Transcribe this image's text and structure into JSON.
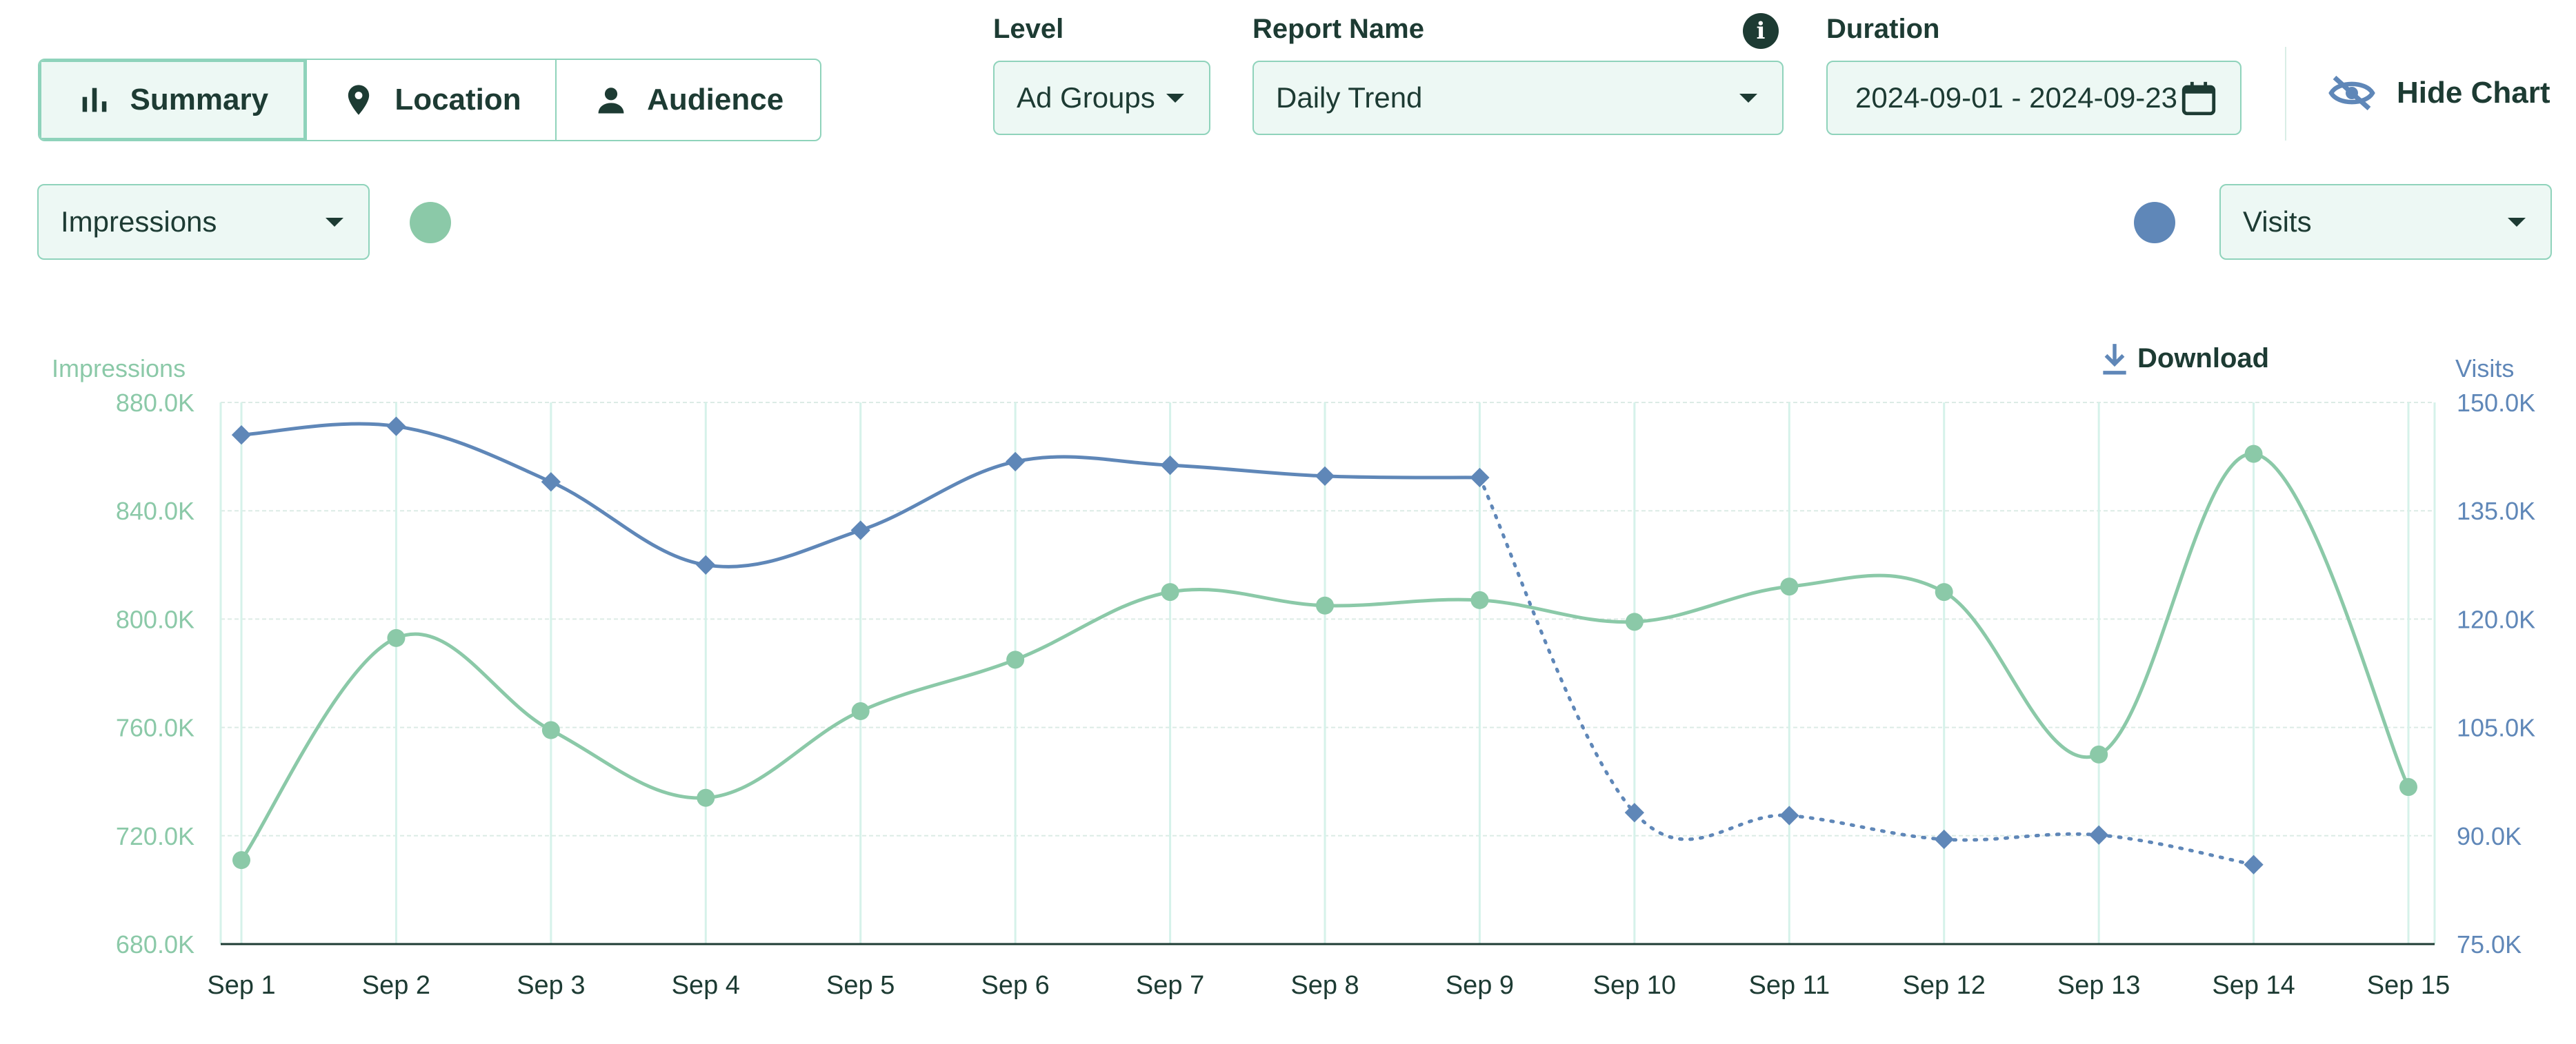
{
  "tabs": [
    {
      "label": "Summary",
      "icon": "bar-chart-icon",
      "active": true
    },
    {
      "label": "Location",
      "icon": "location-pin-icon",
      "active": false
    },
    {
      "label": "Audience",
      "icon": "person-icon",
      "active": false
    }
  ],
  "filters": {
    "level_label": "Level",
    "level_value": "Ad Groups",
    "report_label": "Report Name",
    "report_value": "Daily Trend",
    "duration_label": "Duration",
    "duration_value": "2024-09-01 - 2024-09-23",
    "info_icon": "info-icon",
    "calendar_icon": "calendar-icon"
  },
  "hide_chart_label": "Hide Chart",
  "metric_left": {
    "value": "Impressions",
    "color": "#8bc9a8"
  },
  "metric_right": {
    "value": "Visits",
    "color": "#5f87b8"
  },
  "download_label": "Download",
  "chart_data": {
    "type": "line",
    "x": [
      "Sep 1",
      "Sep 2",
      "Sep 3",
      "Sep 4",
      "Sep 5",
      "Sep 6",
      "Sep 7",
      "Sep 8",
      "Sep 9",
      "Sep 10",
      "Sep 11",
      "Sep 12",
      "Sep 13",
      "Sep 14",
      "Sep 15"
    ],
    "y_left": {
      "label": "Impressions",
      "lim": [
        680,
        880
      ],
      "ticks": [
        "680.0K",
        "720.0K",
        "760.0K",
        "800.0K",
        "840.0K",
        "880.0K"
      ]
    },
    "y_right": {
      "label": "Visits",
      "lim": [
        75,
        150
      ],
      "ticks": [
        "75.0K",
        "90.0K",
        "105.0K",
        "120.0K",
        "135.0K",
        "150.0K"
      ]
    },
    "series": [
      {
        "name": "Impressions",
        "axis": "left",
        "color": "#8bc9a8",
        "values": [
          711,
          793,
          759,
          734,
          766,
          785,
          810,
          805,
          807,
          799,
          812,
          810,
          750,
          861,
          738
        ]
      },
      {
        "name": "Visits",
        "axis": "right",
        "color": "#5f87b8",
        "values": [
          145.5,
          146.7,
          139,
          127.5,
          132.3,
          141.8,
          141.3,
          139.8,
          139.6,
          93.2,
          92.8,
          89.5,
          90.1,
          86
        ]
      }
    ],
    "grid": true,
    "legend": "none"
  }
}
